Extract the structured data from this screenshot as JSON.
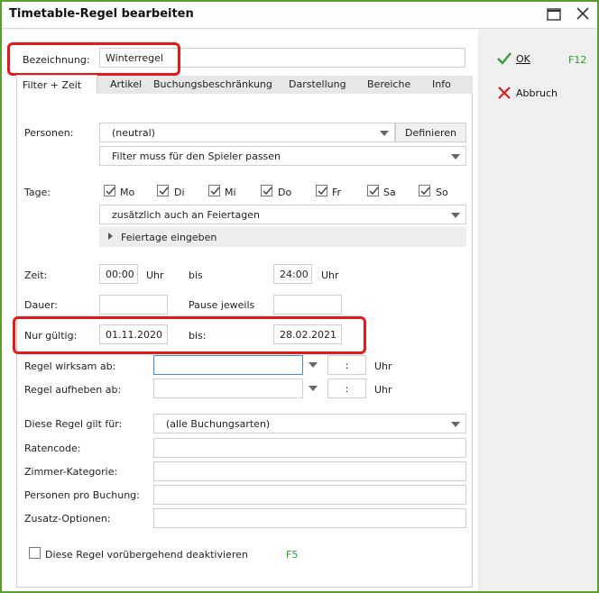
{
  "window": {
    "title": "Timetable-Regel bearbeiten"
  },
  "bezeichnung": {
    "label": "Bezeichnung:",
    "value": "Winterregel"
  },
  "tabs": [
    {
      "label": "Filter + Zeit",
      "active": true
    },
    {
      "label": "Artikel"
    },
    {
      "label": "Buchungsbeschränkung"
    },
    {
      "label": "Darstellung"
    },
    {
      "label": "Bereiche"
    },
    {
      "label": "Info"
    }
  ],
  "personen": {
    "label": "Personen:",
    "value": "(neutral)",
    "define_label": "Definieren",
    "filter_value": "Filter muss für den Spieler passen"
  },
  "tage": {
    "label": "Tage:",
    "days": [
      {
        "label": "Mo",
        "checked": true
      },
      {
        "label": "Di",
        "checked": true
      },
      {
        "label": "Mi",
        "checked": true
      },
      {
        "label": "Do",
        "checked": true
      },
      {
        "label": "Fr",
        "checked": true
      },
      {
        "label": "Sa",
        "checked": true
      },
      {
        "label": "So",
        "checked": true
      }
    ],
    "holiday_option": "zusätzlich auch an Feiertagen",
    "holiday_enter": "Feiertage eingeben"
  },
  "zeit": {
    "label": "Zeit:",
    "from": "00:00",
    "from_unit": "Uhr",
    "bis": "bis",
    "to": "24:00",
    "to_unit": "Uhr"
  },
  "dauer": {
    "label": "Dauer:",
    "value": "",
    "pause_label": "Pause jeweils",
    "pause_value": ""
  },
  "gueltig": {
    "label": "Nur gültig:",
    "from": "01.11.2020",
    "bis": "bis:",
    "to": "28.02.2021"
  },
  "wirksam": {
    "label": "Regel wirksam ab:",
    "value": "",
    "time": ":",
    "unit": "Uhr"
  },
  "aufheben": {
    "label": "Regel aufheben ab:",
    "value": "",
    "time": ":",
    "unit": "Uhr"
  },
  "gilt_fuer": {
    "label": "Diese Regel gilt für:",
    "value": "(alle Buchungsarten)"
  },
  "ratencode": {
    "label": "Ratencode:",
    "value": ""
  },
  "zimmer": {
    "label": "Zimmer-Kategorie:",
    "value": ""
  },
  "personen_buchung": {
    "label": "Personen pro Buchung:",
    "value": ""
  },
  "zusatz": {
    "label": "Zusatz-Optionen:",
    "value": ""
  },
  "deactivate": {
    "label": "Diese Regel vorübergehend deaktivieren",
    "shortcut": "F5",
    "checked": false
  },
  "side": {
    "ok_label": "OK",
    "ok_shortcut": "F12",
    "cancel_label": "Abbruch"
  },
  "colors": {
    "window_border": "#5aa02c",
    "highlight": "#e81818",
    "shortcut": "#2e9b2e",
    "focus": "#3c8fd6"
  }
}
